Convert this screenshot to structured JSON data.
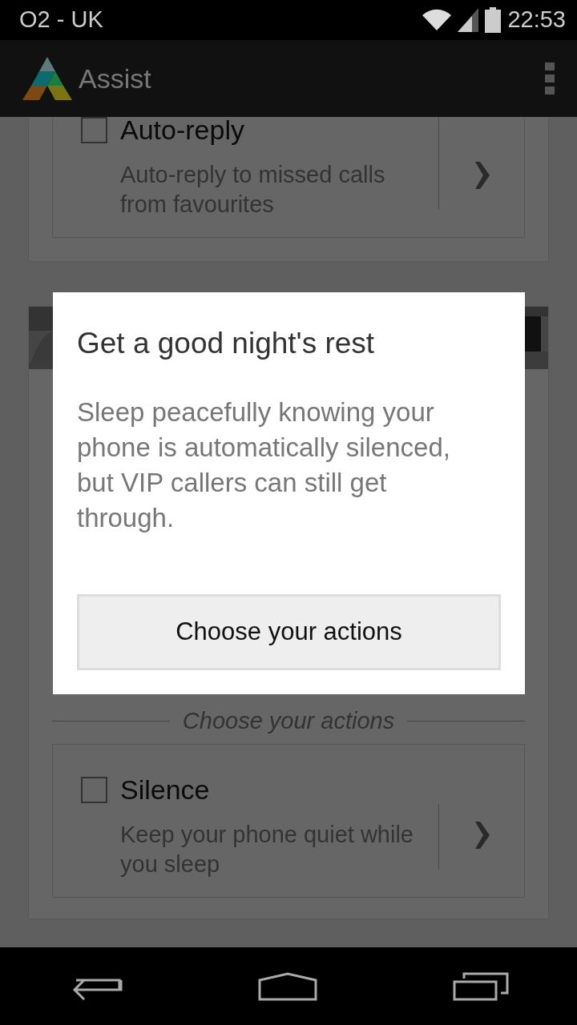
{
  "status_bar": {
    "carrier": "O2 - UK",
    "time": "22:53"
  },
  "app_bar": {
    "title": "Assist"
  },
  "auto_reply_card": {
    "action": {
      "title": "Auto-reply",
      "description": "Auto-reply to missed calls from favourites",
      "checked": false
    }
  },
  "sleep_card": {
    "section_label": "Choose your actions",
    "action": {
      "title": "Silence",
      "description": "Keep your phone quiet while you sleep",
      "checked": false
    }
  },
  "dialog": {
    "title": "Get a good night's rest",
    "message": "Sleep peacefully knowing your phone is automatically silenced, but VIP callers can still get through.",
    "button": "Choose your actions"
  }
}
